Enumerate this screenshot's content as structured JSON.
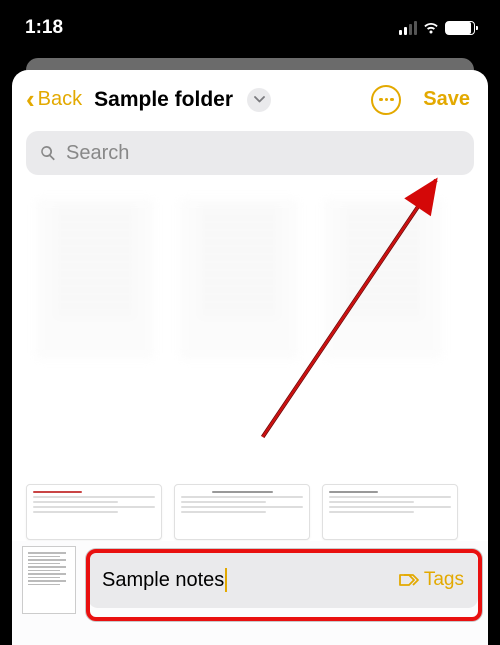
{
  "status": {
    "time": "1:18"
  },
  "nav": {
    "back": "Back",
    "folder_title": "Sample folder",
    "save": "Save"
  },
  "search": {
    "placeholder": "Search"
  },
  "input": {
    "note_title": "Sample notes",
    "tags_label": "Tags"
  },
  "colors": {
    "accent": "#e3a900",
    "highlight": "#e91010"
  }
}
